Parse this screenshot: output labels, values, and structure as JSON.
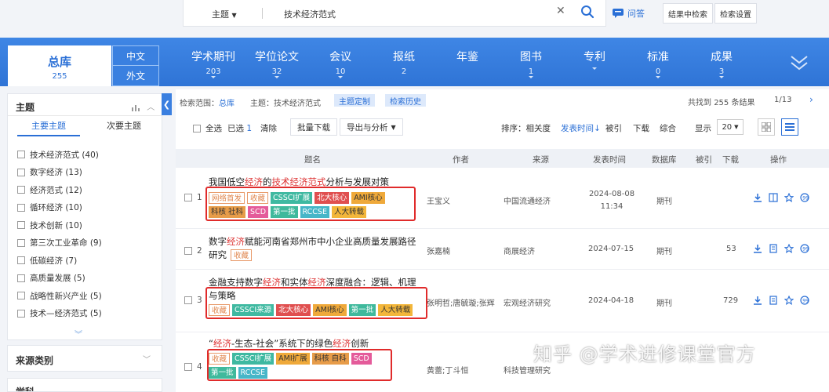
{
  "search": {
    "field": "主题",
    "query": "技术经济范式",
    "ask_label": "问答",
    "secondary_search_label": "结果中检索",
    "search_settings_label": "检索设置"
  },
  "nav": {
    "total": {
      "label": "总库",
      "count": "255"
    },
    "lang_zh": "中文",
    "lang_en": "外文",
    "items": [
      {
        "label": "学术期刊",
        "count": "203"
      },
      {
        "label": "学位论文",
        "count": "32"
      },
      {
        "label": "会议",
        "count": "10"
      },
      {
        "label": "报纸",
        "count": "2"
      },
      {
        "label": "年鉴",
        "count": ""
      },
      {
        "label": "图书",
        "count": "1"
      },
      {
        "label": "专利",
        "count": ""
      },
      {
        "label": "标准",
        "count": "0"
      },
      {
        "label": "成果",
        "count": "3"
      }
    ]
  },
  "sidebar": {
    "title": "主题",
    "tabs": [
      "主要主题",
      "次要主题"
    ],
    "items": [
      "技术经济范式 (40)",
      "数字经济 (13)",
      "经济范式 (12)",
      "循环经济 (10)",
      "技术创新 (10)",
      "第三次工业革命 (9)",
      "低碳经济 (7)",
      "高质量发展 (5)",
      "战略性新兴产业 (5)",
      "技术—经济范式 (5)"
    ],
    "panel_source": "来源类别",
    "panel_subject": "学科"
  },
  "results": {
    "scope_label": "检索范围：",
    "scope_value": "总库",
    "topic_label": "主题：技术经济范式",
    "customize_label": "主题定制",
    "history_label": "检索历史",
    "found_prefix": "共找到",
    "found_count": "255",
    "found_suffix": "条结果",
    "page": "1/13",
    "select_all": "全选",
    "selected": "已选",
    "selected_count": "1",
    "clear": "清除",
    "batch_download": "批量下载",
    "export": "导出与分析",
    "sort_label": "排序：",
    "sort_relevance": "相关度",
    "sort_date": "发表时间",
    "sort_cited": "被引",
    "sort_downloads": "下载",
    "sort_composite": "综合",
    "display_label": "显示",
    "page_size": "20"
  },
  "table": {
    "headers": [
      "题名",
      "作者",
      "来源",
      "发表时间",
      "数据库",
      "被引",
      "下载",
      "操作"
    ],
    "rows": [
      {
        "num": "1",
        "title_parts": [
          "我国低空",
          "经济",
          "的",
          "技术经济范式",
          "分析与发展对策"
        ],
        "tags": [
          "网络首发",
          "收藏",
          "CSSCI扩展",
          "北大核心",
          "AMI核心",
          "科核 社科",
          "SCD",
          "第一批",
          "RCCSE",
          "人大转载"
        ],
        "author": "王宝义",
        "source": "中国流通经济",
        "date": "2024-08-08 11:34",
        "db": "期刊",
        "cited": "",
        "downloads": ""
      },
      {
        "num": "2",
        "title_parts": [
          "数字",
          "经济",
          "赋能河南省郑州市中小企业高质量发展路径研究"
        ],
        "tags": [
          "收藏"
        ],
        "author": "张嘉楠",
        "source": "商展经济",
        "date": "2024-07-15",
        "db": "期刊",
        "cited": "",
        "downloads": "53"
      },
      {
        "num": "3",
        "title_parts": [
          "金融支持数字",
          "经济",
          "和实体",
          "经济",
          "深度融合：逻辑、机理与策略"
        ],
        "tags": [
          "收藏",
          "CSSCI来源",
          "北大核心",
          "AMI核心",
          "第一批",
          "人大转载"
        ],
        "author": "张明哲;唐毓璇;张辉",
        "source": "宏观经济研究",
        "date": "2024-04-18",
        "db": "期刊",
        "cited": "",
        "downloads": "729"
      },
      {
        "num": "4",
        "title_parts": [
          "“",
          "经济",
          "-生态-社会”系统下的绿色",
          "经济",
          "创新"
        ],
        "tags": [
          "收藏",
          "CSSCI扩展",
          "AMI扩展",
          "科核 自科",
          "SCD",
          "第一批",
          "RCCSE"
        ],
        "author": "黄蕾;丁斗恒",
        "source": "科技管理研究",
        "date": "",
        "db": "",
        "cited": "",
        "downloads": ""
      }
    ]
  },
  "watermark": "知乎 @学术进修课堂官方",
  "colors": {
    "brand": "#2f74d6",
    "highlight": "#e02b2b",
    "keyword": "#d33333"
  }
}
